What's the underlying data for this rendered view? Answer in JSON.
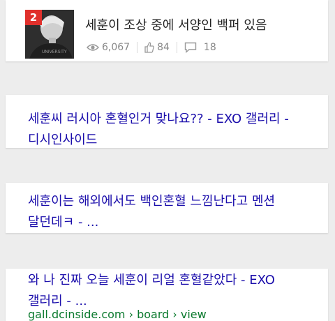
{
  "top_post": {
    "rank": "2",
    "title": "세훈이 조상 중에 서양인 백퍼 있음",
    "views": "6,067",
    "likes": "84",
    "comments": "18",
    "icons": [
      "eye-icon",
      "thumbs-up-icon",
      "comment-icon"
    ],
    "rank_color": "#e0302c"
  },
  "results": [
    {
      "title_line1": "세훈씨 러시아 혼혈인거 맞나요?? - EXO 갤러리 -",
      "title_line2": "디시인사이드"
    },
    {
      "title_line1": "세훈이는 해외에서도 백인혼혈 느낌난다고 멘션",
      "title_line2": "달던데ㅋ - ..."
    },
    {
      "title_line1": "와 나 진짜 오늘 세훈이 리얼 혼혈같았다 - EXO",
      "title_line2": "갤러리 - ...",
      "url": "gall.dcinside.com › board › view"
    }
  ],
  "colors": {
    "link": "#1a0dab",
    "url": "#0b7a2e",
    "background": "#ededed"
  }
}
